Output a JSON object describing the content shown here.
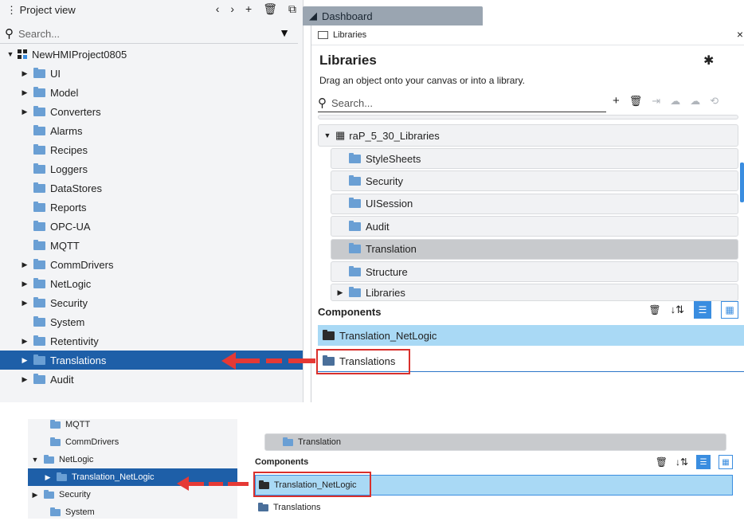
{
  "project_view": {
    "title": "Project view",
    "search_placeholder": "Search...",
    "tree": [
      {
        "label": "NewHMIProject0805",
        "expander": "▼",
        "icon": "project-icon",
        "indent": 0
      },
      {
        "label": "UI",
        "expander": "▶",
        "icon": "folder-icon",
        "indent": 1
      },
      {
        "label": "Model",
        "expander": "▶",
        "icon": "folder-icon",
        "indent": 1
      },
      {
        "label": "Converters",
        "expander": "▶",
        "icon": "folder-icon",
        "indent": 1
      },
      {
        "label": "Alarms",
        "expander": "",
        "icon": "folder-icon",
        "indent": 1
      },
      {
        "label": "Recipes",
        "expander": "",
        "icon": "folder-icon",
        "indent": 1
      },
      {
        "label": "Loggers",
        "expander": "",
        "icon": "folder-icon",
        "indent": 1
      },
      {
        "label": "DataStores",
        "expander": "",
        "icon": "folder-icon",
        "indent": 1
      },
      {
        "label": "Reports",
        "expander": "",
        "icon": "folder-icon",
        "indent": 1
      },
      {
        "label": "OPC-UA",
        "expander": "",
        "icon": "folder-icon",
        "indent": 1
      },
      {
        "label": "MQTT",
        "expander": "",
        "icon": "folder-icon",
        "indent": 1
      },
      {
        "label": "CommDrivers",
        "expander": "▶",
        "icon": "folder-icon",
        "indent": 1
      },
      {
        "label": "NetLogic",
        "expander": "▶",
        "icon": "folder-icon",
        "indent": 1
      },
      {
        "label": "Security",
        "expander": "▶",
        "icon": "folder-icon",
        "indent": 1
      },
      {
        "label": "System",
        "expander": "",
        "icon": "folder-icon",
        "indent": 1
      },
      {
        "label": "Retentivity",
        "expander": "▶",
        "icon": "folder-icon",
        "indent": 1
      },
      {
        "label": "Translations",
        "expander": "▶",
        "icon": "folder-icon",
        "indent": 1,
        "selected": true
      },
      {
        "label": "Audit",
        "expander": "▶",
        "icon": "folder-icon",
        "indent": 1
      }
    ]
  },
  "editor_tab": {
    "label": "Dashboard"
  },
  "libraries": {
    "window_title": "Libraries",
    "heading": "Libraries",
    "subtitle": "Drag an object onto your canvas or into a library.",
    "search_placeholder": "Search...",
    "library_name": "raP_5_30_Libraries",
    "items": [
      "StyleSheets",
      "Security",
      "UISession",
      "Audit",
      "Translation",
      "Structure",
      "Libraries"
    ],
    "components_title": "Components",
    "components": [
      "Translation_NetLogic",
      "Translations"
    ]
  },
  "bottom": {
    "tree": [
      "MQTT",
      "CommDrivers",
      "NetLogic",
      "Translation_NetLogic",
      "Security",
      "System"
    ],
    "library_item": "Translation",
    "components_title": "Components",
    "components": [
      "Translation_NetLogic",
      "Translations"
    ]
  },
  "colors": {
    "selection": "#1e5fa8",
    "component_highlight": "#a9d9f5",
    "callout": "#d9302c",
    "arrow": "#e53935"
  }
}
